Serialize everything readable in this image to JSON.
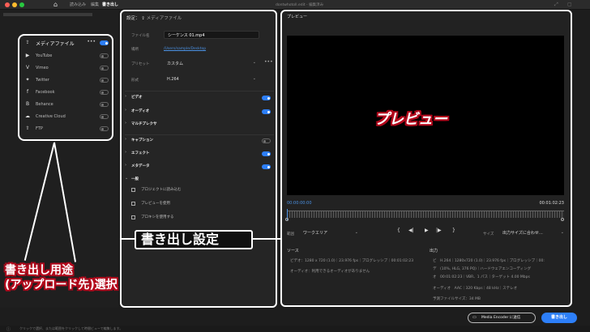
{
  "titlebar": {
    "tabs": [
      "読み込み",
      "編集",
      "書き出し"
    ],
    "active_tab": "書き出し",
    "project": "dontwhotoll.edit - 編集済み"
  },
  "destinations": {
    "items": [
      {
        "label": "メディアファイル",
        "icon": "file-export-icon",
        "glyph": "⇪",
        "on": true,
        "more": "•••"
      },
      {
        "label": "YouTube",
        "icon": "youtube-icon",
        "glyph": "▶",
        "on": false
      },
      {
        "label": "Vimeo",
        "icon": "vimeo-icon",
        "glyph": "V",
        "on": false
      },
      {
        "label": "Twitter",
        "icon": "twitter-icon",
        "glyph": "✦",
        "on": false
      },
      {
        "label": "Facebook",
        "icon": "facebook-icon",
        "glyph": "f",
        "on": false
      },
      {
        "label": "Behance",
        "icon": "behance-icon",
        "glyph": "B",
        "on": false
      },
      {
        "label": "Creative Cloud",
        "icon": "creative-cloud-icon",
        "glyph": "☁",
        "on": false
      },
      {
        "label": "FTP",
        "icon": "ftp-icon",
        "glyph": "⇧",
        "on": false
      }
    ]
  },
  "settings": {
    "title": "設定：",
    "subtitle": "メディアファイル",
    "filename_label": "ファイル名",
    "filename_value": "シーケンス 01.mp4",
    "location_label": "場所",
    "location_value": "/Users/sample/Desktop",
    "preset_label": "プリセット",
    "preset_value": "カスタム",
    "format_label": "形式",
    "format_value": "H.264",
    "sections": [
      {
        "label": "ビデオ",
        "on": true
      },
      {
        "label": "オーディオ",
        "on": true
      },
      {
        "label": "マルチプレクサ",
        "on": null
      },
      {
        "label": "キャプション",
        "on": false
      },
      {
        "label": "エフェクト",
        "on": true
      },
      {
        "label": "メタデータ",
        "on": true
      }
    ],
    "general_label": "一般",
    "checkboxes": [
      "プロジェクトに読み込む",
      "プレビューを使用",
      "プロキシを使用する"
    ]
  },
  "preview": {
    "title": "プレビュー",
    "current_tc": "00:00:00:00",
    "duration_tc": "00:01:02:23",
    "range_label": "範囲",
    "range_value": "ワークエリア",
    "size_label": "サイズ",
    "size_value": "出力サイズに合わせ…",
    "source_head": "ソース",
    "source_video": "ビデオ：1280 x 720 (1.0)｜23.976 fps｜プログレッシブ｜00:01:02:23",
    "source_audio": "オーディオ：利用できるオーディオがありません",
    "output_head": "出力",
    "output_video1": "ビ　H.264｜1280x720 (1.0)｜23.976 fps｜プログレッシブ｜00:",
    "output_video2": "デ　(10%, HLG, 376 PQ)｜ハードウェアエンコーディング",
    "output_video3": "オ　00:01:02:23｜VBR、1 パス｜ターゲット 4.00 Mbps",
    "output_audio": "オーディオ　AAC｜320 Kbps｜48 kHz｜ステレオ",
    "output_size": "予測ファイルサイズ：34 MB"
  },
  "annotations": {
    "preview": "プレビュー",
    "settings": "書き出し設定",
    "destination_line1": "書き出し用途",
    "destination_line2": "(アップロード先)選択"
  },
  "footer": {
    "media_encoder": "Media Encoder に送信",
    "export": "書き出し",
    "status": "クリックで選択、または範囲をクリックして時間ビューで編集します。"
  }
}
